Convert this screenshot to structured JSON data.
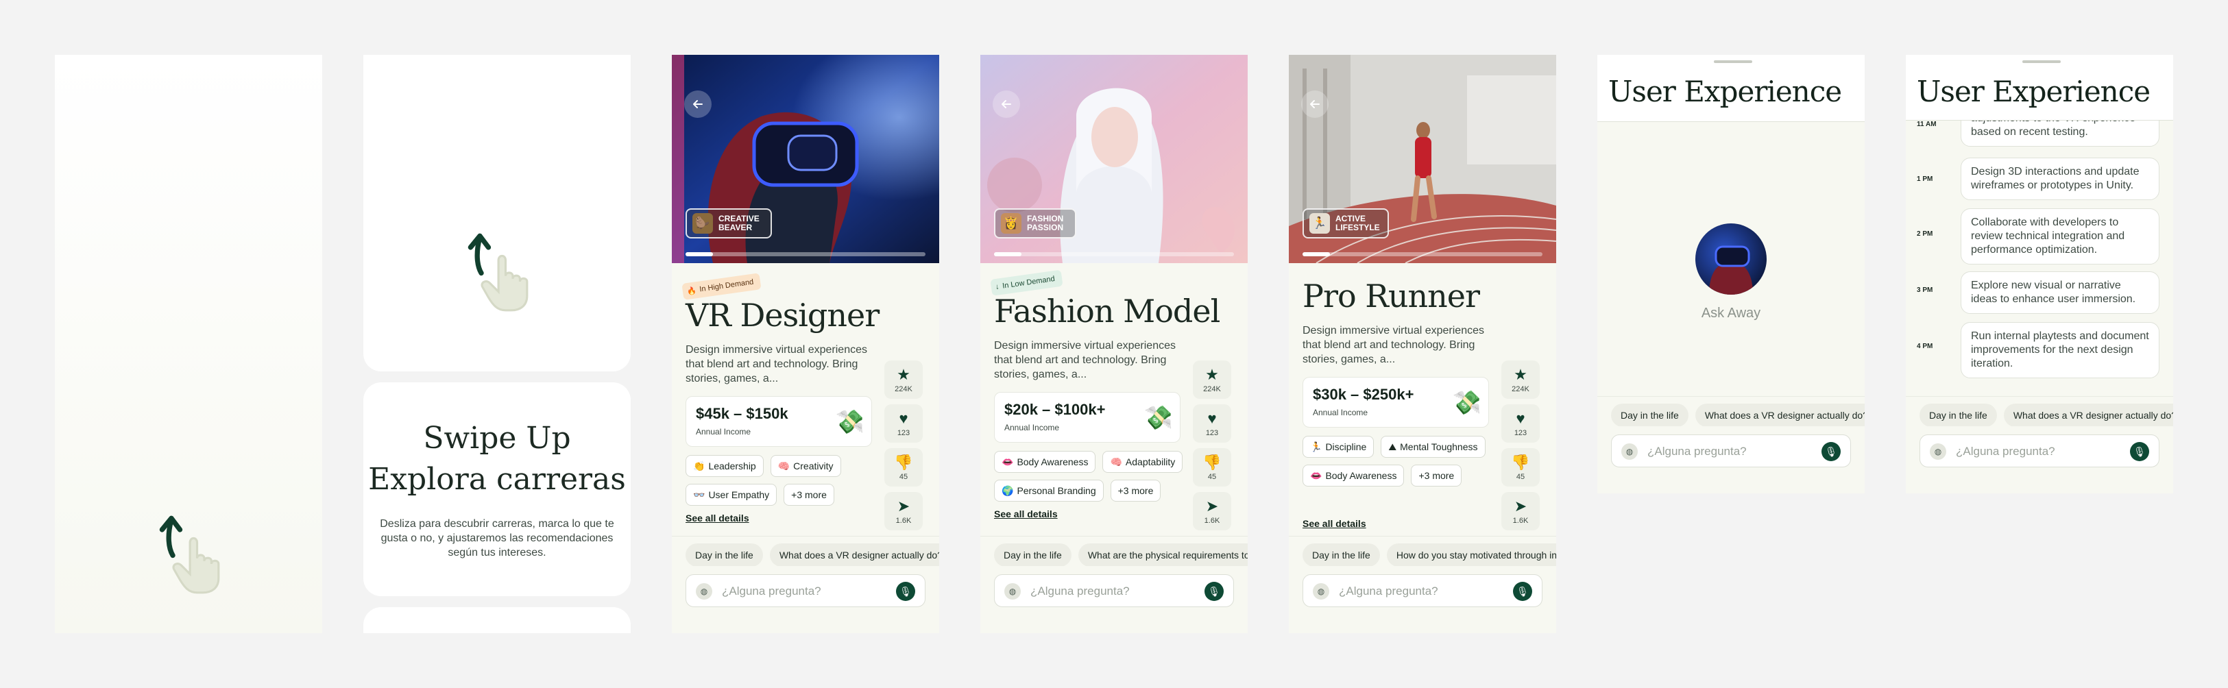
{
  "screen2": {
    "heading_line1": "Swipe Up",
    "heading_line2": "Explora carreras",
    "description": "Desliza para descubrir carreras, marca lo que te gusta o no, y ajustaremos las recomendaciones según tus intereses."
  },
  "cards": [
    {
      "persona": "CREATIVE BEAVER",
      "persona_icon": "🦫",
      "tag": "In High Demand",
      "tag_icon": "🔥",
      "title": "VR Designer",
      "description": "Design immersive virtual experiences that blend art and technology. Bring stories, games, a...",
      "income": "$45k – $150k",
      "income_label": "Annual Income",
      "chips": [
        {
          "icon": "👏",
          "label": "Leadership"
        },
        {
          "icon": "🧠",
          "label": "Creativity"
        },
        {
          "icon": "👓",
          "label": "User Empathy"
        },
        {
          "icon": "",
          "label": "+3 more"
        }
      ],
      "see_all": "See all details",
      "stats": {
        "stars": "224K",
        "likes": "123",
        "dislikes": "45",
        "shares": "1.6K"
      },
      "questions": [
        "Day in the life",
        "What does a VR designer actually do?"
      ],
      "placeholder": "¿Alguna pregunta?"
    },
    {
      "persona": "FASHION PASSION",
      "persona_icon": "👸",
      "tag": "In Low Demand",
      "tag_icon": "↓",
      "title": "Fashion Model",
      "description": "Design immersive virtual experiences that blend art and technology. Bring stories, games, a...",
      "income": "$20k – $100k+",
      "income_label": "Annual Income",
      "chips": [
        {
          "icon": "👄",
          "label": "Body Awareness"
        },
        {
          "icon": "🧠",
          "label": "Adaptability"
        },
        {
          "icon": "🌍",
          "label": "Personal Branding"
        },
        {
          "icon": "",
          "label": "+3 more"
        }
      ],
      "see_all": "See all details",
      "stats": {
        "stars": "224K",
        "likes": "123",
        "dislikes": "45",
        "shares": "1.6K"
      },
      "questions": [
        "Day in the life",
        "What are the physical requirements to"
      ],
      "placeholder": "¿Alguna pregunta?"
    },
    {
      "persona": "ACTIVE LIFESTYLE",
      "persona_icon": "🏃",
      "tag": "",
      "title": "Pro Runner",
      "description": "Design immersive virtual experiences that blend art and technology. Bring stories, games, a...",
      "income": "$30k – $250k+",
      "income_label": "Annual Income",
      "chips": [
        {
          "icon": "🏃",
          "label": "Discipline"
        },
        {
          "icon": "⛰",
          "label": "Mental Toughness"
        },
        {
          "icon": "👄",
          "label": "Body Awareness"
        },
        {
          "icon": "",
          "label": "+3 more"
        }
      ],
      "see_all": "See all details",
      "stats": {
        "stars": "224K",
        "likes": "123",
        "dislikes": "45",
        "shares": "1.6K"
      },
      "questions": [
        "Day in the life",
        "How do you stay motivated through inj"
      ],
      "placeholder": "¿Alguna pregunta?"
    }
  ],
  "ux1": {
    "title": "User Experience",
    "ask_away": "Ask Away",
    "questions": [
      "Day in the life",
      "What does a VR designer actually do?"
    ],
    "placeholder": "¿Alguna pregunta?"
  },
  "ux2": {
    "title": "User Experience",
    "timeline": [
      {
        "time": "11 AM",
        "text": "adjustments to the VR experience based on recent testing."
      },
      {
        "time": "1 PM",
        "text": "Design 3D interactions and update wireframes or prototypes in Unity."
      },
      {
        "time": "2 PM",
        "text": "Collaborate with developers to review technical integration and performance optimization."
      },
      {
        "time": "3 PM",
        "text": "Explore new visual or narrative ideas to enhance user immersion."
      },
      {
        "time": "4 PM",
        "text": "Run internal playtests and document improvements for the next design iteration."
      }
    ],
    "questions": [
      "Day in the life",
      "What does a VR designer actually do?"
    ],
    "placeholder": "¿Alguna pregunta?"
  },
  "colors": {
    "accent": "#0e4a35",
    "card_bg": "#f7f8f1",
    "page_bg": "#f3f3f3"
  },
  "icons": [
    "back-arrow-icon",
    "swipe-up-hand-icon",
    "star-icon",
    "heart-icon",
    "thumbs-down-icon",
    "send-icon",
    "mic-icon",
    "attach-icon",
    "money-icon"
  ]
}
